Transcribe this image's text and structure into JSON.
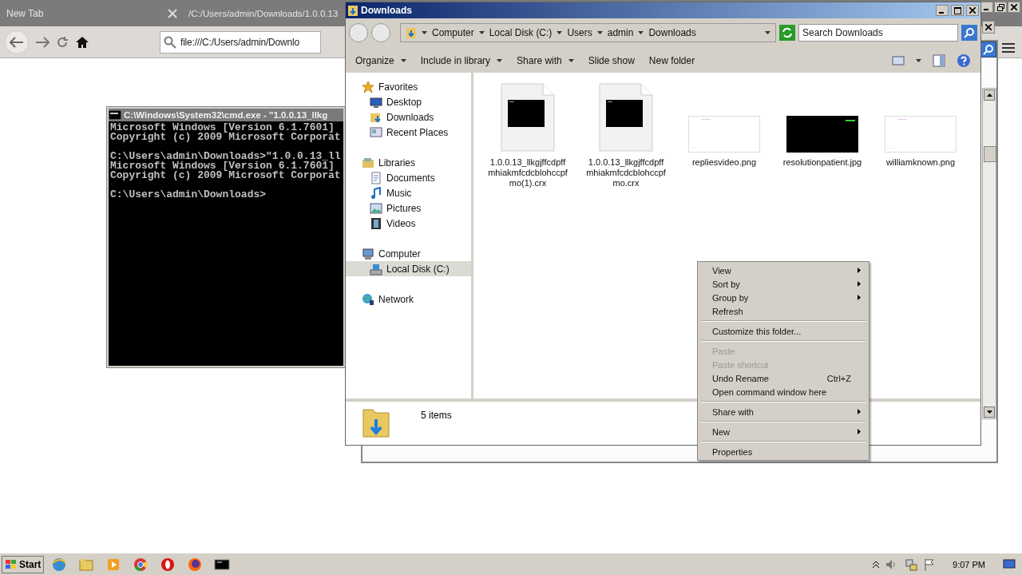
{
  "browser": {
    "tabs": [
      {
        "label": "New Tab",
        "selected": false
      },
      {
        "label": "/C:/Users/admin/Downloads/1.0.0.13",
        "selected": false
      }
    ],
    "url": "file:///C:/Users/admin/Downlo"
  },
  "console": {
    "title": "C:\\Windows\\System32\\cmd.exe - \"1.0.0.13_llkg",
    "blocks": [
      [
        "Microsoft Windows [Version 6.1.7601]",
        "Copyright (c) 2009 Microsoft Corporat"
      ],
      [
        "C:\\Users\\admin\\Downloads>\"1.0.0.13_ll",
        "Microsoft Windows [Version 6.1.7601]",
        "Copyright (c) 2009 Microsoft Corporat"
      ],
      [
        "C:\\Users\\admin\\Downloads>"
      ]
    ]
  },
  "explorer": {
    "title": "Downloads",
    "breadcrumbs": [
      "Computer",
      "Local Disk (C:)",
      "Users",
      "admin",
      "Downloads"
    ],
    "search": {
      "placeholder": "Search Downloads"
    },
    "toolbar": [
      {
        "label": "Organize",
        "dropdown": true
      },
      {
        "label": "Include in library",
        "dropdown": true
      },
      {
        "label": "Share with",
        "dropdown": true
      },
      {
        "label": "Slide show",
        "dropdown": false
      },
      {
        "label": "New folder",
        "dropdown": false
      }
    ],
    "nav": [
      {
        "label": "Favorites",
        "kind": "favorites",
        "selected": false,
        "children": [
          {
            "label": "Desktop",
            "kind": "desktop",
            "selected": false
          },
          {
            "label": "Downloads",
            "kind": "downloads",
            "selected": false
          },
          {
            "label": "Recent Places",
            "kind": "recent",
            "selected": false
          }
        ]
      },
      {
        "label": "Libraries",
        "kind": "libraries",
        "selected": false,
        "children": [
          {
            "label": "Documents",
            "kind": "documents",
            "selected": false
          },
          {
            "label": "Music",
            "kind": "music",
            "selected": false
          },
          {
            "label": "Pictures",
            "kind": "pictures",
            "selected": false
          },
          {
            "label": "Videos",
            "kind": "videos",
            "selected": false
          }
        ]
      },
      {
        "label": "Computer",
        "kind": "computer",
        "selected": false,
        "children": [
          {
            "label": "Local Disk (C:)",
            "kind": "disk",
            "selected": true
          }
        ]
      },
      {
        "label": "Network",
        "kind": "network",
        "selected": false
      }
    ],
    "files": [
      {
        "name": "1.0.0.13_llkgjffcdpffmhiakmfcdcblohccpfmo(1).crx",
        "kind": "app"
      },
      {
        "name": "1.0.0.13_llkgjffcdpffmhiakmfcdcblohccpfmo.crx",
        "kind": "app"
      },
      {
        "name": "repliesvideo.png",
        "kind": "light-image"
      },
      {
        "name": "resolutionpatient.jpg",
        "kind": "dark-image"
      },
      {
        "name": "williamknown.png",
        "kind": "light-image"
      }
    ],
    "status": "5 items"
  },
  "context_menu": [
    {
      "kind": "item",
      "label": "View",
      "submenu": true,
      "disabled": false
    },
    {
      "kind": "item",
      "label": "Sort by",
      "submenu": true,
      "disabled": false
    },
    {
      "kind": "item",
      "label": "Group by",
      "submenu": true,
      "disabled": false
    },
    {
      "kind": "item",
      "label": "Refresh",
      "submenu": false,
      "disabled": false
    },
    {
      "kind": "separator"
    },
    {
      "kind": "item",
      "label": "Customize this folder...",
      "submenu": false,
      "disabled": false
    },
    {
      "kind": "separator"
    },
    {
      "kind": "item",
      "label": "Paste",
      "submenu": false,
      "disabled": true
    },
    {
      "kind": "item",
      "label": "Paste shortcut",
      "submenu": false,
      "disabled": true
    },
    {
      "kind": "item",
      "label": "Undo Rename",
      "shortcut": "Ctrl+Z",
      "submenu": false,
      "disabled": false
    },
    {
      "kind": "item",
      "label": "Open command window here",
      "submenu": false,
      "disabled": false
    },
    {
      "kind": "separator"
    },
    {
      "kind": "item",
      "label": "Share with",
      "submenu": true,
      "disabled": false
    },
    {
      "kind": "separator"
    },
    {
      "kind": "item",
      "label": "New",
      "submenu": true,
      "disabled": false
    },
    {
      "kind": "separator"
    },
    {
      "kind": "item",
      "label": "Properties",
      "submenu": false,
      "disabled": false
    }
  ],
  "taskbar": {
    "start": "Start",
    "apps": [
      {
        "kind": "ie"
      },
      {
        "kind": "explorer"
      },
      {
        "kind": "media"
      },
      {
        "kind": "chrome"
      },
      {
        "kind": "opera"
      },
      {
        "kind": "firefox"
      },
      {
        "kind": "cmd"
      }
    ],
    "clock": "9:07 PM"
  }
}
